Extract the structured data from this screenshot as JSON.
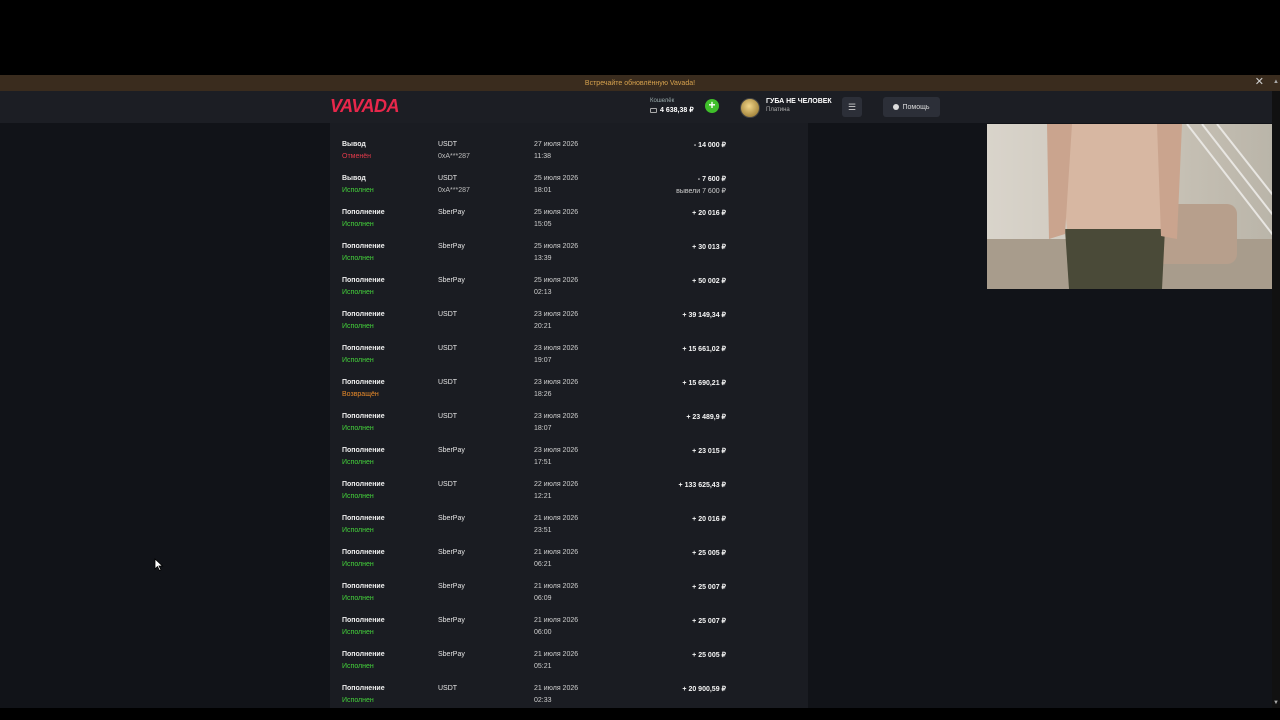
{
  "banner": {
    "text": "Встречайте обновлённую Vavada!",
    "close_icon": "close-icon"
  },
  "header": {
    "logo": "VAVADA",
    "wallet_label": "Кошелёк",
    "balance": "4 638,38 ₽",
    "user_name": "ГУБА НЕ ЧЕЛОВЕК",
    "user_level": "Платина",
    "menu_icon": "☰",
    "help_label": "Помощь"
  },
  "colors": {
    "accent": "#e8274b",
    "status_done": "#44d23b",
    "status_cancel": "#e23a4b",
    "status_return": "#e88a2a"
  },
  "transactions": [
    {
      "type": "Вывод",
      "status": "Отменён",
      "status_kind": "cancel",
      "method": "USDT",
      "address": "0xA***287",
      "date": "27 июля 2026",
      "time": "11:38",
      "amount": "- 14 000 ₽",
      "note": ""
    },
    {
      "type": "Вывод",
      "status": "Исполнен",
      "status_kind": "done",
      "method": "USDT",
      "address": "0xA***287",
      "date": "25 июля 2026",
      "time": "18:01",
      "amount": "- 7 600 ₽",
      "note": "вывели 7 600 ₽"
    },
    {
      "type": "Пополнение",
      "status": "Исполнен",
      "status_kind": "done",
      "method": "SberPay",
      "address": "",
      "date": "25 июля 2026",
      "time": "15:05",
      "amount": "+ 20 016 ₽",
      "note": ""
    },
    {
      "type": "Пополнение",
      "status": "Исполнен",
      "status_kind": "done",
      "method": "SberPay",
      "address": "",
      "date": "25 июля 2026",
      "time": "13:39",
      "amount": "+ 30 013 ₽",
      "note": ""
    },
    {
      "type": "Пополнение",
      "status": "Исполнен",
      "status_kind": "done",
      "method": "SberPay",
      "address": "",
      "date": "25 июля 2026",
      "time": "02:13",
      "amount": "+ 50 002 ₽",
      "note": ""
    },
    {
      "type": "Пополнение",
      "status": "Исполнен",
      "status_kind": "done",
      "method": "USDT",
      "address": "",
      "date": "23 июля 2026",
      "time": "20:21",
      "amount": "+ 39 149,34 ₽",
      "note": ""
    },
    {
      "type": "Пополнение",
      "status": "Исполнен",
      "status_kind": "done",
      "method": "USDT",
      "address": "",
      "date": "23 июля 2026",
      "time": "19:07",
      "amount": "+ 15 661,02 ₽",
      "note": ""
    },
    {
      "type": "Пополнение",
      "status": "Возвращён",
      "status_kind": "return",
      "method": "USDT",
      "address": "",
      "date": "23 июля 2026",
      "time": "18:26",
      "amount": "+ 15 690,21 ₽",
      "note": ""
    },
    {
      "type": "Пополнение",
      "status": "Исполнен",
      "status_kind": "done",
      "method": "USDT",
      "address": "",
      "date": "23 июля 2026",
      "time": "18:07",
      "amount": "+ 23 489,9 ₽",
      "note": ""
    },
    {
      "type": "Пополнение",
      "status": "Исполнен",
      "status_kind": "done",
      "method": "SberPay",
      "address": "",
      "date": "23 июля 2026",
      "time": "17:51",
      "amount": "+ 23 015 ₽",
      "note": ""
    },
    {
      "type": "Пополнение",
      "status": "Исполнен",
      "status_kind": "done",
      "method": "USDT",
      "address": "",
      "date": "22 июля 2026",
      "time": "12:21",
      "amount": "+ 133 625,43 ₽",
      "note": ""
    },
    {
      "type": "Пополнение",
      "status": "Исполнен",
      "status_kind": "done",
      "method": "SberPay",
      "address": "",
      "date": "21 июля 2026",
      "time": "23:51",
      "amount": "+ 20 016 ₽",
      "note": ""
    },
    {
      "type": "Пополнение",
      "status": "Исполнен",
      "status_kind": "done",
      "method": "SberPay",
      "address": "",
      "date": "21 июля 2026",
      "time": "06:21",
      "amount": "+ 25 005 ₽",
      "note": ""
    },
    {
      "type": "Пополнение",
      "status": "Исполнен",
      "status_kind": "done",
      "method": "SberPay",
      "address": "",
      "date": "21 июля 2026",
      "time": "06:09",
      "amount": "+ 25 007 ₽",
      "note": ""
    },
    {
      "type": "Пополнение",
      "status": "Исполнен",
      "status_kind": "done",
      "method": "SberPay",
      "address": "",
      "date": "21 июля 2026",
      "time": "06:00",
      "amount": "+ 25 007 ₽",
      "note": ""
    },
    {
      "type": "Пополнение",
      "status": "Исполнен",
      "status_kind": "done",
      "method": "SberPay",
      "address": "",
      "date": "21 июля 2026",
      "time": "05:21",
      "amount": "+ 25 005 ₽",
      "note": ""
    },
    {
      "type": "Пополнение",
      "status": "Исполнен",
      "status_kind": "done",
      "method": "USDT",
      "address": "",
      "date": "21 июля 2026",
      "time": "02:33",
      "amount": "+ 20 900,59 ₽",
      "note": ""
    }
  ]
}
